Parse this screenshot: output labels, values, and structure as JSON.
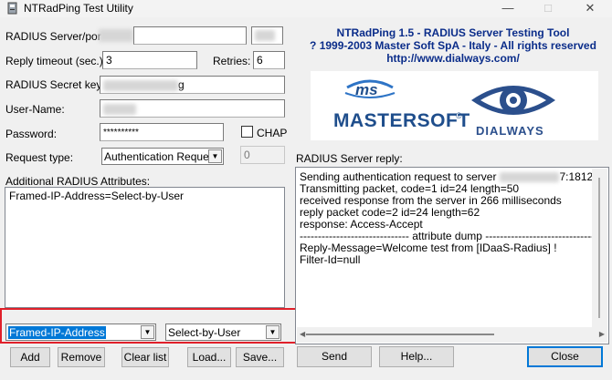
{
  "window": {
    "title": "NTRadPing Test Utility",
    "minimize": "—",
    "maximize": "□",
    "close": "✕"
  },
  "header": {
    "line1": "NTRadPing 1.5 - RADIUS Server Testing Tool",
    "line2": "? 1999-2003 Master Soft SpA - Italy - All rights reserved",
    "line3": "http://www.dialways.com/"
  },
  "logos": {
    "ms": "ms",
    "mastersoft": "MASTERSOFT",
    "registered": "®",
    "dialways": "DIALWAYS"
  },
  "form": {
    "server_label": "RADIUS Server/por",
    "timeout_label": "Reply timeout (sec.):",
    "timeout_value": "3",
    "retries_label": "Retries:",
    "retries_value": "6",
    "secret_label": "RADIUS Secret key:",
    "secret_value_tail": "g",
    "username_label": "User-Name:",
    "password_label": "Password:",
    "password_value": "**********",
    "chap_label": "CHAP",
    "request_type_label": "Request type:",
    "request_type_value": "Authentication Request",
    "request_number_value": "0",
    "attributes_label": "Additional RADIUS Attributes:",
    "attributes_value": "Framed-IP-Address=Select-by-User",
    "attr_name_value": "Framed-IP-Address",
    "attr_value_value": "Select-by-User"
  },
  "reply": {
    "label": "RADIUS Server reply:",
    "line1_start": "Sending authentication request to server",
    "line1_end": "7:1812",
    "lines": [
      "Transmitting packet, code=1 id=24 length=50",
      "received response from the server in 266 milliseconds",
      "reply packet code=2 id=24 length=62",
      "response: Access-Accept",
      "------------------------------ attribute dump ------------------------------",
      "Reply-Message=Welcome test from [IDaaS-Radius] !",
      "Filter-Id=null"
    ]
  },
  "buttons": {
    "add": "Add",
    "remove": "Remove",
    "clear": "Clear list",
    "load": "Load...",
    "save": "Save...",
    "send": "Send",
    "help": "Help...",
    "close": "Close"
  },
  "colors": {
    "highlight_box": "#e0202a",
    "selection": "#0078d7",
    "logo_blue": "#1f4e8c",
    "logo_red": "#cc2229",
    "dialways_blue": "#2b4f8c",
    "header_blue": "#0b2d8a"
  }
}
